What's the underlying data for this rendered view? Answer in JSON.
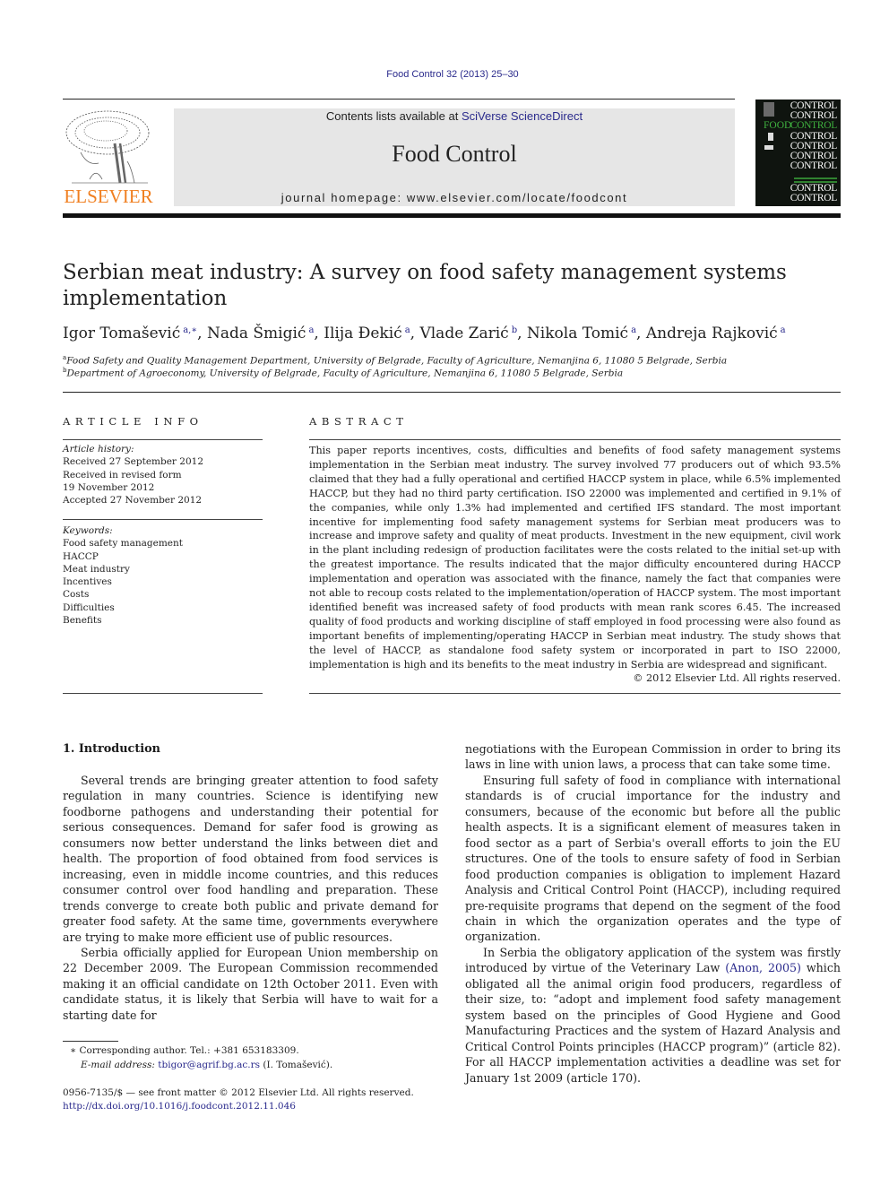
{
  "header": {
    "journal_ref": "Food Control 32 (2013) 25–30",
    "publisher_logo_text": "ELSEVIER",
    "contents_prefix": "Contents lists available at ",
    "contents_link": "SciVerse ScienceDirect",
    "journal_title": "Food Control",
    "homepage_prefix": "journal homepage: ",
    "homepage_url": "www.elsevier.com/locate/foodcont",
    "cover": {
      "word": "CONTROL",
      "food_word": "FOOD",
      "colors": {
        "background": "#0f140f",
        "accent": "#3fb23f",
        "text": "#ffffff"
      }
    }
  },
  "article": {
    "title": "Serbian meat industry: A survey on food safety management systems implementation",
    "authors": [
      {
        "name": "Igor Tomašević",
        "sup": "a,∗"
      },
      {
        "name": "Nada Šmigić",
        "sup": "a"
      },
      {
        "name": "Ilija Đekić",
        "sup": "a"
      },
      {
        "name": "Vlade Zarić",
        "sup": "b"
      },
      {
        "name": "Nikola Tomić",
        "sup": "a"
      },
      {
        "name": "Andreja Rajković",
        "sup": "a"
      }
    ],
    "affiliations": [
      {
        "mark": "a",
        "text": "Food Safety and Quality Management Department, University of Belgrade, Faculty of Agriculture, Nemanjina 6, 11080 5 Belgrade, Serbia"
      },
      {
        "mark": "b",
        "text": "Department of Agroeconomy, University of Belgrade, Faculty of Agriculture, Nemanjina 6, 11080 5 Belgrade, Serbia"
      }
    ]
  },
  "article_info": {
    "heading": "ARTICLE INFO",
    "history_label": "Article history:",
    "history": [
      "Received 27 September 2012",
      "Received in revised form",
      "19 November 2012",
      "Accepted 27 November 2012"
    ],
    "keywords_label": "Keywords:",
    "keywords": [
      "Food safety management",
      "HACCP",
      "Meat industry",
      "Incentives",
      "Costs",
      "Difficulties",
      "Benefits"
    ]
  },
  "abstract": {
    "heading": "ABSTRACT",
    "text": "This paper reports incentives, costs, difficulties and benefits of food safety management systems implementation in the Serbian meat industry. The survey involved 77 producers out of which 93.5% claimed that they had a fully operational and certified HACCP system in place, while 6.5% implemented HACCP, but they had no third party certification. ISO 22000 was implemented and certified in 9.1% of the companies, while only 1.3% had implemented and certified IFS standard. The most important incentive for implementing food safety management systems for Serbian meat producers was to increase and improve safety and quality of meat products. Investment in the new equipment, civil work in the plant including redesign of production facilitates were the costs related to the initial set-up with the greatest importance. The results indicated that the major difficulty encountered during HACCP implementation and operation was associated with the finance, namely the fact that companies were not able to recoup costs related to the implementation/operation of HACCP system. The most important identified benefit was increased safety of food products with mean rank scores 6.45. The increased quality of food products and working discipline of staff employed in food processing were also found as important benefits of implementing/operating HACCP in Serbian meat industry. The study shows that the level of HACCP, as standalone food safety system or incorporated in part to ISO 22000, implementation is high and its benefits to the meat industry in Serbia are widespread and significant.",
    "copyright": "© 2012 Elsevier Ltd. All rights reserved."
  },
  "body": {
    "section_heading": "1.  Introduction",
    "left_paragraphs": [
      "Several trends are bringing greater attention to food safety regulation in many countries. Science is identifying new foodborne pathogens and understanding their potential for serious conse­quences. Demand for safer food is growing as consumers now better understand the links between diet and health. The propor­tion of food obtained from food services is increasing, even in middle income countries, and this reduces consumer control over food handling and preparation. These trends converge to create both public and private demand for greater food safety. At the same time, governments everywhere are trying to make more efficient use of public resources.",
      "Serbia officially applied for European Union membership on 22 December 2009. The European Commission recommended making it an official candidate on 12th October 2011. Even with candidate status, it is likely that Serbia will have to wait for a starting date for"
    ],
    "right_continuation": "negotiations with the European Commission in order to bring its laws in line with union laws, a process that can take some time.",
    "right_paragraph_2": "Ensuring full safety of food in compliance with international standards is of crucial importance for the industry and consumers, because of the economic but before all the public health aspects. It is a significant element of measures taken in food sector as a part of Serbia's overall efforts to join the EU structures. One of the tools to ensure safety of food in Serbian food production companies is obligation to implement Hazard Analysis and Critical Control Point (HACCP), including required pre-requisite programs that depend on the segment of the food chain in which the organization operates and the type of organization.",
    "right_paragraph_3_before": "In Serbia the obligatory application of the system was firstly introduced by virtue of the Veterinary Law ",
    "right_paragraph_3_citation": "(Anon, 2005)",
    "right_paragraph_3_after": " which obligated all the animal origin food producers, regardless of their size, to: “adopt and implement food safety management system based on the principles of Good Hygiene and Good Manufacturing Practices and the system of Hazard Analysis and Critical Control Points principles (HACCP program)” (article 82). For all HACCP implementation activities a deadline was set for January 1st 2009 (article 170)."
  },
  "footnotes": {
    "corresponding": "∗  Corresponding author. Tel.: +381 653183309.",
    "email_label": "E-mail address: ",
    "email": "tbigor@agrif.bg.ac.rs",
    "email_suffix": " (I. Tomašević).",
    "front_matter": "0956-7135/$ — see front matter © 2012 Elsevier Ltd. All rights reserved.",
    "doi": "http://dx.doi.org/10.1016/j.foodcont.2012.11.046"
  },
  "colors": {
    "link": "#2a2a8c",
    "elsevier_orange": "#f07f20",
    "masthead_bg": "#e6e6e6"
  }
}
